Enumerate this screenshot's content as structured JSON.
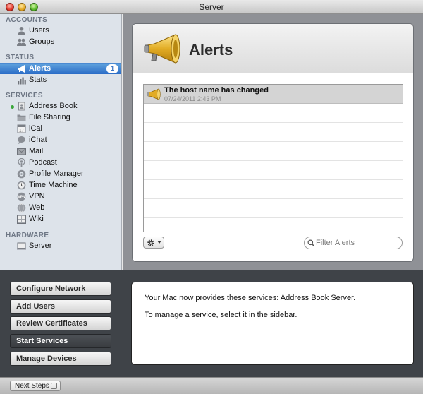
{
  "window": {
    "title": "Server"
  },
  "sidebar": {
    "sections": [
      {
        "header": "ACCOUNTS",
        "items": [
          {
            "label": "Users",
            "icon": "user-icon"
          },
          {
            "label": "Groups",
            "icon": "group-icon"
          }
        ]
      },
      {
        "header": "STATUS",
        "items": [
          {
            "label": "Alerts",
            "icon": "megaphone-icon",
            "badge": "1",
            "selected": true
          },
          {
            "label": "Stats",
            "icon": "chart-icon"
          }
        ]
      },
      {
        "header": "SERVICES",
        "items": [
          {
            "label": "Address Book",
            "icon": "address-book-icon",
            "running": true
          },
          {
            "label": "File Sharing",
            "icon": "folder-icon"
          },
          {
            "label": "iCal",
            "icon": "calendar-icon"
          },
          {
            "label": "iChat",
            "icon": "chat-icon"
          },
          {
            "label": "Mail",
            "icon": "mail-icon"
          },
          {
            "label": "Podcast",
            "icon": "podcast-icon"
          },
          {
            "label": "Profile Manager",
            "icon": "profile-manager-icon"
          },
          {
            "label": "Time Machine",
            "icon": "time-machine-icon"
          },
          {
            "label": "VPN",
            "icon": "vpn-icon"
          },
          {
            "label": "Web",
            "icon": "globe-icon"
          },
          {
            "label": "Wiki",
            "icon": "wiki-icon"
          }
        ]
      },
      {
        "header": "HARDWARE",
        "items": [
          {
            "label": "Server",
            "icon": "server-icon"
          }
        ]
      }
    ]
  },
  "alerts_panel": {
    "title": "Alerts",
    "alerts": [
      {
        "title": "The host name has changed",
        "date": "07/24/2011 2:43 PM"
      }
    ],
    "filter_placeholder": "Filter Alerts"
  },
  "setup_buttons": [
    {
      "label": "Configure Network",
      "active": false
    },
    {
      "label": "Add Users",
      "active": false
    },
    {
      "label": "Review Certificates",
      "active": false
    },
    {
      "label": "Start Services",
      "active": true
    },
    {
      "label": "Manage Devices",
      "active": false
    }
  ],
  "info": {
    "line1": "Your Mac now provides these services: Address Book Server.",
    "line2": "To manage a service, select it in the sidebar."
  },
  "footer": {
    "next_steps_label": "Next Steps"
  },
  "colors": {
    "selection": "#2a6cc7",
    "running_dot": "#3aa63a",
    "badge_text": "#3a74c4"
  }
}
